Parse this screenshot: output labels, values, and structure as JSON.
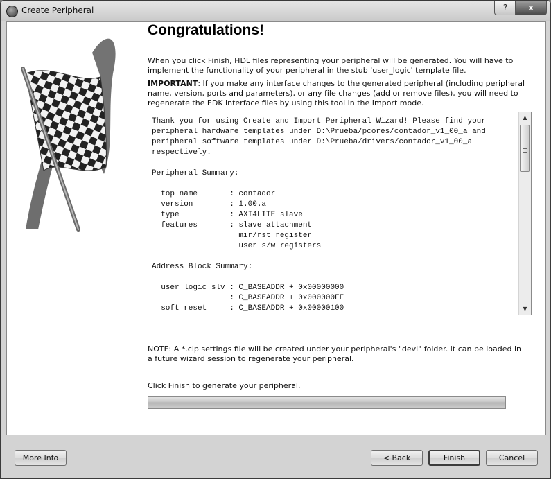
{
  "window": {
    "title": "Create Peripheral",
    "help_glyph": "?",
    "close_glyph": "x"
  },
  "heading": "Congratulations!",
  "intro": "When you click Finish, HDL files representing your peripheral will be generated. You will have to implement the functionality of your peripheral in the stub 'user_logic' template file.",
  "important_label": "IMPORTANT",
  "important_text": ": If you make any interface changes to the generated peripheral (including peripheral name, version, ports and parameters), or any file changes (add or remove files), you will need to regenerate the EDK interface files by using this tool in the Import mode.",
  "summary_text": "Thank you for using Create and Import Peripheral Wizard! Please find your\nperipheral hardware templates under D:\\Prueba/pcores/contador_v1_00_a and\nperipheral software templates under D:\\Prueba/drivers/contador_v1_00_a\nrespectively.\n\nPeripheral Summary:\n\n  top name       : contador\n  version        : 1.00.a\n  type           : AXI4LITE slave\n  features       : slave attachment\n                   mir/rst register\n                   user s/w registers\n\nAddress Block Summary:\n\n  user logic slv : C_BASEADDR + 0x00000000\n                 : C_BASEADDR + 0x000000FF\n  soft reset     : C_BASEADDR + 0x00000100",
  "note": "NOTE: A *.cip settings file will be created under your peripheral's \"devl\" folder. It can be loaded in a future  wizard session to regenerate your peripheral.",
  "finish_hint": "Click Finish to generate your peripheral.",
  "buttons": {
    "more_info": "More Info",
    "back": "< Back",
    "finish": "Finish",
    "cancel": "Cancel"
  },
  "icons": {
    "app": "peripheral-wizard-icon",
    "flag": "checkered-flag-icon"
  },
  "progress": 0
}
